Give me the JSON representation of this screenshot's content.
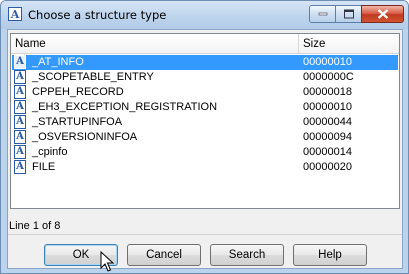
{
  "window": {
    "title": "Choose a structure type",
    "app_icon": "structure-icon"
  },
  "columns": {
    "name": "Name",
    "size": "Size"
  },
  "rows": [
    {
      "name": "_AT_INFO",
      "size": "00000010",
      "selected": true
    },
    {
      "name": "_SCOPETABLE_ENTRY",
      "size": "0000000C",
      "selected": false
    },
    {
      "name": "CPPEH_RECORD",
      "size": "00000018",
      "selected": false
    },
    {
      "name": "_EH3_EXCEPTION_REGISTRATION",
      "size": "00000010",
      "selected": false
    },
    {
      "name": "_STARTUPINFOA",
      "size": "00000044",
      "selected": false
    },
    {
      "name": "_OSVERSIONINFOA",
      "size": "00000094",
      "selected": false
    },
    {
      "name": "_cpinfo",
      "size": "00000014",
      "selected": false
    },
    {
      "name": "FILE",
      "size": "00000020",
      "selected": false
    }
  ],
  "row_icon_glyph": "A",
  "status": "Line 1 of 8",
  "buttons": {
    "ok": "OK",
    "cancel": "Cancel",
    "search": "Search",
    "help": "Help"
  },
  "colors": {
    "selection": "#3399ff",
    "close_button": "#c03a22"
  }
}
